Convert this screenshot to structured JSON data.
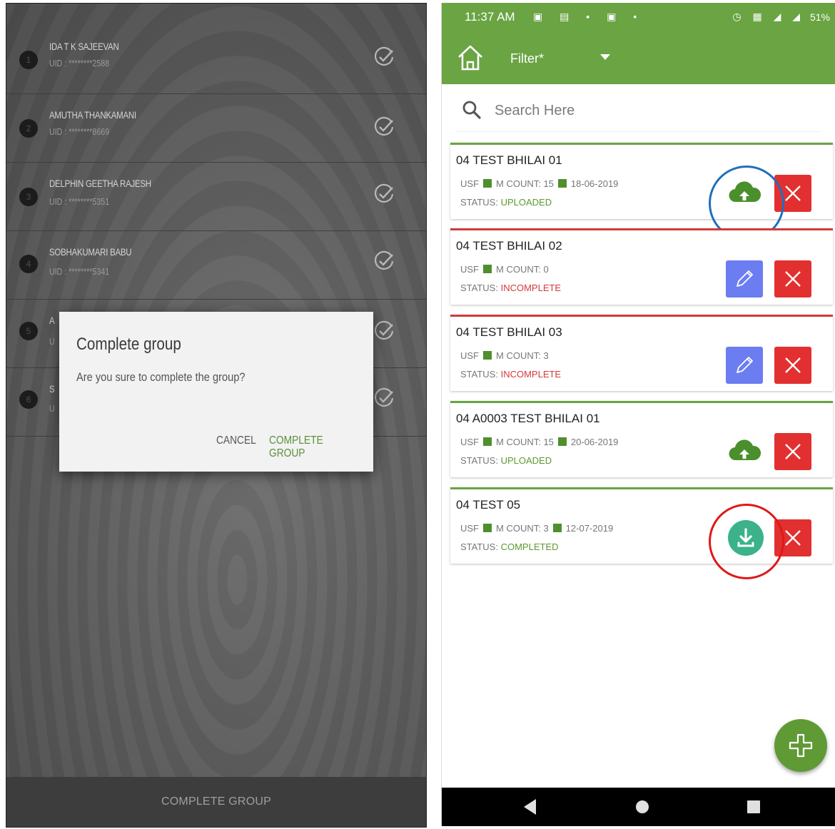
{
  "left_panel": {
    "members": [
      {
        "num": "1",
        "name": "IDA T K SAJEEVAN",
        "uid": "UID : ********2588"
      },
      {
        "num": "2",
        "name": "AMUTHA THANKAMANI",
        "uid": "UID : ********8669"
      },
      {
        "num": "3",
        "name": "DELPHIN GEETHA RAJESH",
        "uid": "UID : ********5351"
      },
      {
        "num": "4",
        "name": "SOBHAKUMARI BABU",
        "uid": "UID : ********5341"
      },
      {
        "num": "5",
        "name": "A",
        "uid": "U"
      },
      {
        "num": "6",
        "name": "S",
        "uid": "U"
      }
    ],
    "dialog": {
      "title": "Complete group",
      "message": "Are you sure to complete the group?",
      "cancel_label": "CANCEL",
      "confirm_label": "COMPLETE GROUP"
    },
    "footer_button": "COMPLETE GROUP"
  },
  "phone": {
    "status_bar": {
      "time": "11:37 AM",
      "battery": "51%"
    },
    "app_bar": {
      "filter_label": "Filter*"
    },
    "search": {
      "placeholder": "Search Here"
    },
    "groups": [
      {
        "title": "04 TEST BHILAI 01",
        "usf": "USF",
        "count": "M COUNT: 15",
        "date": "18-06-2019",
        "status_label": "STATUS:",
        "status": "UPLOADED"
      },
      {
        "title": "04 TEST BHILAI 02",
        "usf": "USF",
        "count": "M COUNT: 0",
        "date": "",
        "status_label": "STATUS:",
        "status": "INCOMPLETE"
      },
      {
        "title": "04 TEST BHILAI 03",
        "usf": "USF",
        "count": "M COUNT: 3",
        "date": "",
        "status_label": "STATUS:",
        "status": "INCOMPLETE"
      },
      {
        "title": "04 A0003 TEST BHILAI 01",
        "usf": "USF",
        "count": "M COUNT: 15",
        "date": "20-06-2019",
        "status_label": "STATUS:",
        "status": "UPLOADED"
      },
      {
        "title": "04 TEST 05",
        "usf": "USF",
        "count": "M COUNT: 3",
        "date": "12-07-2019",
        "status_label": "STATUS:",
        "status": "COMPLETED"
      }
    ],
    "colors": {
      "primary_green": "#6aa443",
      "delete_red": "#e23030",
      "edit_blue": "#6b7df0",
      "download_teal": "#3bb28a",
      "highlight_blue": "#1f6fbd",
      "highlight_red": "#e01818"
    }
  }
}
